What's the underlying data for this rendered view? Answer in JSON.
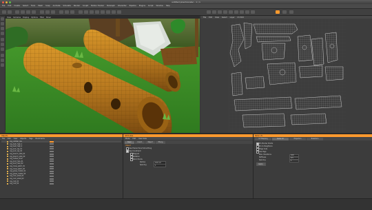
{
  "window": {
    "title": "untitled pixelmonster - 1 / 1"
  },
  "menu": {
    "items": [
      "File",
      "Edit",
      "Create",
      "Select",
      "Tools",
      "Mesh",
      "Snap",
      "Animate",
      "Simulate",
      "Render",
      "Sculpt",
      "Motion Tracker",
      "MoGraph",
      "Character",
      "Pipeline",
      "Plugins",
      "Script",
      "Window",
      "Help"
    ]
  },
  "viewport": {
    "header": [
      "View",
      "Cameras",
      "Display",
      "Options",
      "Filter",
      "Panel"
    ]
  },
  "uv_editor": {
    "header": [
      "File",
      "Edit",
      "View",
      "Select",
      "Layer",
      "UV Edit"
    ]
  },
  "objects_panel": {
    "title": "Objects",
    "menu": [
      "File",
      "Edit",
      "View",
      "Objects",
      "Tags",
      "Bookmarks"
    ],
    "rows": [
      "Log_collider_low",
      "Log_bark_high_1",
      "Log_bark_high_2",
      "Log_end_cap_01",
      "Log_end_cap_02",
      "Log_branch_stub_01",
      "Log_branch_stub_02",
      "Log_hollow_inner",
      "Log_knot_hole_01",
      "Log_knot_hole_02",
      "Log_moss_patch_01",
      "Log_moss_patch_02",
      "Log_grass_cluster_01",
      "Log_grass_cluster_02",
      "Log_rock_small_01",
      "Log_rock_small_02",
      "Log_root_01",
      "Log_root_02"
    ]
  },
  "attributes_panel": {
    "title": "Attributes",
    "menu": [
      "Mode",
      "Edit",
      "User Data"
    ],
    "tabs": [
      "Basic",
      "Coord.",
      "Object",
      "Phong"
    ],
    "section": "Object",
    "rows": [
      {
        "label": "Use Hierarchical Smoothing",
        "checked": false
      },
      {
        "label": "Use Constraint",
        "checked": true
      },
      {
        "label": "Magnet",
        "checked": false
      },
      {
        "label": "Rotation",
        "checked": false
      },
      {
        "label": "Stick Points",
        "checked": false
      }
    ],
    "fields": [
      {
        "label": "Radius",
        "value": "100 cm"
      },
      {
        "label": "Spacing",
        "value": "1"
      }
    ]
  },
  "texture_panel": {
    "title": "Relax UV",
    "tabs": [
      "UV Mapping",
      "Relax UV",
      "Projection",
      "Transform"
    ],
    "rows": [
      {
        "label": "Pin Border Points",
        "checked": true
      },
      {
        "label": "Pin to Neighbors",
        "checked": false
      },
      {
        "label": "Edge Cuts",
        "checked": false
      },
      {
        "label": "Use Tags",
        "checked": false
      }
    ],
    "fields": [
      {
        "label": "Max. Iterations",
        "value": "100"
      },
      {
        "label": "Stiffness",
        "value": "0.5"
      },
      {
        "label": "Spacing",
        "value": "1"
      }
    ],
    "apply_label": "Apply"
  },
  "colors": {
    "accent": "#ff9a2e",
    "log_wood": "#b8791f",
    "grass": "#3d8f2a",
    "uv_background": "#3d3d3d"
  }
}
